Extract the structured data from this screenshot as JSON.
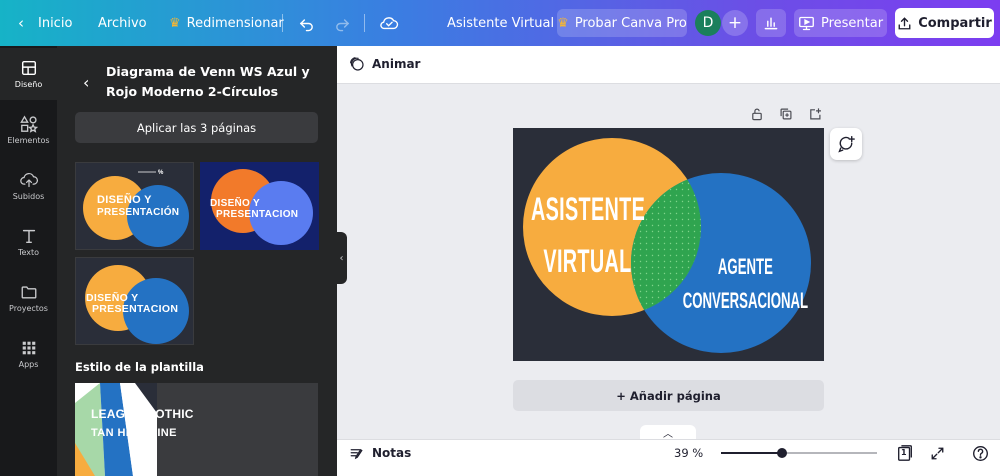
{
  "topbar": {
    "home_label": "Inicio",
    "file_label": "Archivo",
    "resize_label": "Redimensionar",
    "doc_title": "Asistente Virtual",
    "try_pro_label": "Probar Canva Pro",
    "avatar_initial": "D",
    "present_label": "Presentar",
    "share_label": "Compartir"
  },
  "rail": {
    "items": [
      {
        "label": "Diseño",
        "icon": "layout-icon",
        "active": true
      },
      {
        "label": "Elementos",
        "icon": "shapes-icon"
      },
      {
        "label": "Subidos",
        "icon": "upload-cloud-icon"
      },
      {
        "label": "Texto",
        "icon": "text-icon"
      },
      {
        "label": "Proyectos",
        "icon": "folder-icon"
      },
      {
        "label": "Apps",
        "icon": "apps-grid-icon"
      }
    ]
  },
  "panel": {
    "template_title": "Diagrama de Venn WS Azul y Rojo Moderno 2-Círculos",
    "apply_label": "Aplicar las 3 páginas",
    "thumbnails": [
      {
        "text_line1": "DISEÑO Y",
        "text_line2": "PRESENTACIÓN",
        "extra": "%"
      },
      {
        "text_line1": "DISEÑO Y",
        "text_line2": "PRESENTACION"
      },
      {
        "text_line1": "DISEÑO Y",
        "text_line2": "PRESENTACION"
      }
    ],
    "style_section_label": "Estilo de la plantilla",
    "style_font_1": "LEAGUE GOTHIC",
    "style_font_2": "TAN HEADLINE"
  },
  "editor": {
    "animate_label": "Animar",
    "design": {
      "left_text_line1": "ASISTENTE",
      "left_text_line2": "VIRTUAL",
      "right_text_line1": "AGENTE",
      "right_text_line2": "CONVERSACIONAL",
      "colors": {
        "background": "#2a2e39",
        "left_circle": "#f7ac3f",
        "right_circle": "#2472c3",
        "overlap": "#2fa44f"
      }
    },
    "add_page_label": "+ Añadir página"
  },
  "bottombar": {
    "notes_label": "Notas",
    "zoom_label": "39 %",
    "zoom_percent": 39,
    "page_number": "1"
  },
  "colors": {
    "accent_purple": "#7c3df0",
    "accent_teal": "#16b3c7",
    "panel_bg": "#252627",
    "rail_bg": "#18191b"
  }
}
